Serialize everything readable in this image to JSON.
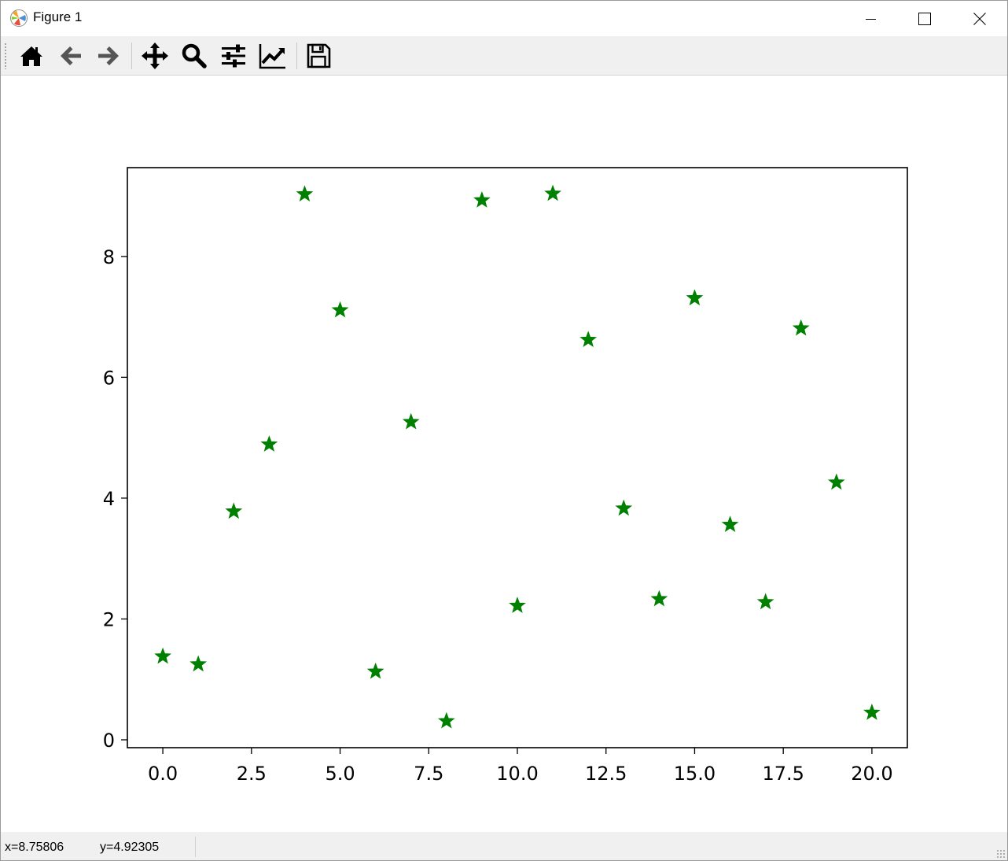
{
  "window": {
    "title": "Figure 1",
    "icons": {
      "app": "matplotlib-logo-icon",
      "minimize": "minimize-icon",
      "maximize": "maximize-icon",
      "close": "close-icon"
    }
  },
  "toolbar": {
    "tools": [
      {
        "name": "home",
        "icon": "home-icon"
      },
      {
        "name": "back",
        "icon": "arrow-left-icon"
      },
      {
        "name": "forward",
        "icon": "arrow-right-icon"
      },
      {
        "name": "pan",
        "icon": "move-icon"
      },
      {
        "name": "zoom",
        "icon": "magnifier-icon"
      },
      {
        "name": "subplots",
        "icon": "sliders-icon"
      },
      {
        "name": "customize",
        "icon": "line-chart-icon"
      },
      {
        "name": "save",
        "icon": "floppy-disk-icon"
      }
    ]
  },
  "status": {
    "x_readout": "x=8.75806",
    "y_readout": "y=4.92305"
  },
  "chart_data": {
    "type": "scatter",
    "marker": "star",
    "color": "#008000",
    "title": "",
    "xlabel": "",
    "ylabel": "",
    "x": [
      0,
      1,
      2,
      3,
      4,
      5,
      6,
      7,
      8,
      9,
      10,
      11,
      12,
      13,
      14,
      15,
      16,
      17,
      18,
      19,
      20
    ],
    "y": [
      1.38,
      1.25,
      3.78,
      4.89,
      9.03,
      7.11,
      1.13,
      5.26,
      0.31,
      8.93,
      2.22,
      9.04,
      6.62,
      3.83,
      2.33,
      7.31,
      3.56,
      2.28,
      6.81,
      4.26,
      0.45
    ],
    "xlim": [
      -1.0,
      21.0
    ],
    "ylim": [
      -0.13,
      9.47
    ],
    "xticks": [
      0,
      2.5,
      5,
      7.5,
      10,
      12.5,
      15,
      17.5,
      20
    ],
    "xtick_labels": [
      "0.0",
      "2.5",
      "5.0",
      "7.5",
      "10.0",
      "12.5",
      "15.0",
      "17.5",
      "20.0"
    ],
    "yticks": [
      0,
      2,
      4,
      6,
      8
    ],
    "ytick_labels": [
      "0",
      "2",
      "4",
      "6",
      "8"
    ],
    "grid": false
  }
}
